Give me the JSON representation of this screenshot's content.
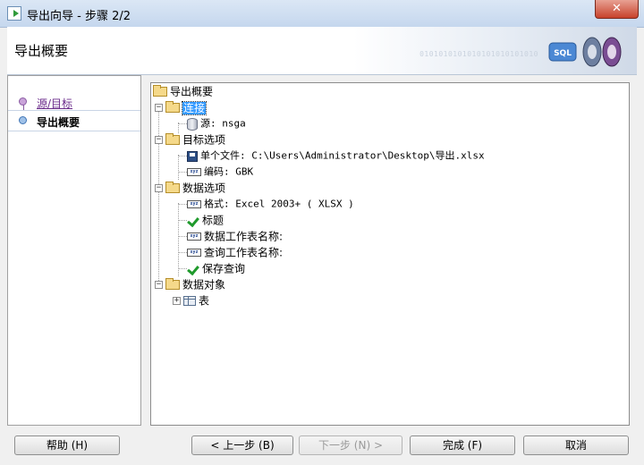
{
  "window": {
    "title": "导出向导 - 步骤 2/2",
    "close_label": "✕"
  },
  "banner": {
    "title": "导出概要",
    "binary_text": "0101010101010101010101010",
    "logo_text": "SQL"
  },
  "nav": {
    "items": [
      {
        "label": "源/目标"
      },
      {
        "label": "导出概要"
      }
    ]
  },
  "tree": {
    "root": "导出概要",
    "connection": {
      "label": "连接",
      "source": "源: nsga"
    },
    "target": {
      "label": "目标选项",
      "file": "单个文件: C:\\Users\\Administrator\\Desktop\\导出.xlsx",
      "encoding": "编码: GBK"
    },
    "data_options": {
      "label": "数据选项",
      "format": "格式: Excel 2003+ ( XLSX )",
      "header": "标题",
      "data_sheet": "数据工作表名称:",
      "query_sheet": "查询工作表名称:",
      "save_query": "保存查询"
    },
    "data_objects": {
      "label": "数据对象",
      "tables": "表"
    }
  },
  "buttons": {
    "help": "帮助 (H)",
    "prev": "< 上一步 (B)",
    "next": "下一步 (N) >",
    "finish": "完成 (F)",
    "cancel": "取消"
  },
  "icon_text": {
    "xyz": "xyz"
  }
}
